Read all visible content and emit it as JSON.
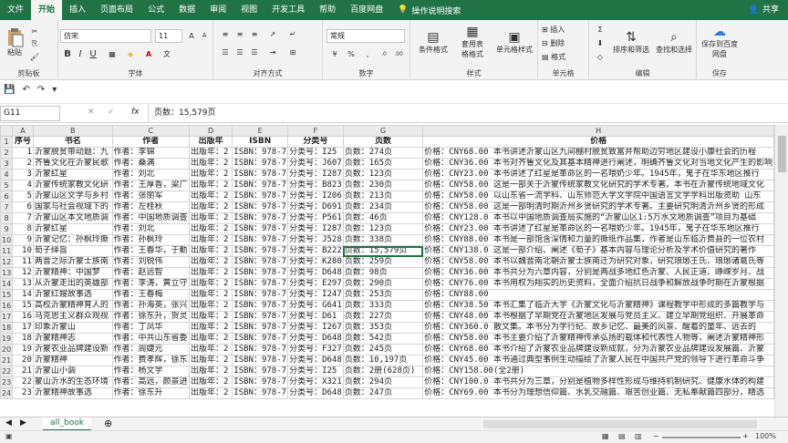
{
  "ribbon_tabs": [
    "文件",
    "开始",
    "插入",
    "页面布局",
    "公式",
    "数据",
    "审阅",
    "视图",
    "开发工具",
    "帮助",
    "百度网盘"
  ],
  "tell_me": "操作说明搜索",
  "share": "共享",
  "groups": {
    "clipboard": {
      "label": "剪贴板",
      "paste": "粘贴"
    },
    "font": {
      "label": "字体",
      "name": "仿宋",
      "size": "11",
      "bold": "B",
      "italic": "I",
      "underline": "U"
    },
    "alignment": {
      "label": "对齐方式"
    },
    "number": {
      "label": "数字",
      "format": "常规"
    },
    "styles": {
      "label": "样式",
      "conditional": "条件格式",
      "table": "套用表格格式",
      "cell_styles": "单元格样式"
    },
    "cells": {
      "label": "单元格",
      "insert": "插入",
      "delete": "删除",
      "format": "格式"
    },
    "editing": {
      "label": "编辑",
      "sort": "排序和筛选",
      "find": "查找和选择"
    },
    "save": {
      "label": "保存",
      "btn": "保存到百度网盘"
    }
  },
  "namebox": "G11",
  "formula": "页数：15,579页",
  "columns": [
    "A",
    "B",
    "C",
    "D",
    "E",
    "F",
    "G",
    "H"
  ],
  "header_row": [
    "序号",
    "书名",
    "作者",
    "出版年",
    "ISBN",
    "分类号",
    "页数",
    "价格"
  ],
  "rows": [
    [
      "1",
      "沂蒙脱贫带动题：九",
      "作者：李锦",
      "出版年：2",
      "ISBN：978-7",
      "分类号：I25",
      "页数：274页",
      "价格：CNY68.00 本书讲述沂蒙山区九间棚村脱贫致富并帮助边穷地区建设小康社会的历程"
    ],
    [
      "2",
      "齐鲁文化在沂蒙民歌",
      "作者：桑满",
      "出版年：2",
      "ISBN：978-7",
      "分类号：J607",
      "页数：165页",
      "价格：CNY36.00 本书对齐鲁文化及其基本精神进行阐述，明确齐鲁文化对当地文化产生的影响"
    ],
    [
      "3",
      "沂蒙红星",
      "作者：刘北",
      "出版年：2",
      "ISBN：978-7",
      "分类号：I287",
      "页数：123页",
      "价格：CNY23.00 本书讲述了红星是革命区的一名喂奶少年。1945年，鬼子在华东地区推行"
    ],
    [
      "4",
      "沂蒙传统家教文化研",
      "作者：王厚香，梁广",
      "出版年：2",
      "ISBN：978-7",
      "分类号：B823",
      "页数：230页",
      "价格：CNY58.00 这是一部关于沂蒙传统家教文化研究的学术专著。本书在沂蒙传统地域文化"
    ],
    [
      "5",
      "沂蒙山区文学与乡村",
      "作者：张丽军",
      "出版年：2",
      "ISBN：978-7",
      "分类号：I206",
      "页数：213页",
      "价格：CNY58.00 以山东省一流学科、山东师范大学文学院中国语言文学学科出版资助 山东"
    ],
    [
      "6",
      "国家与社会视域下的",
      "作者：左桂秋",
      "出版年：2",
      "ISBN：978-7",
      "分类号：D691",
      "页数：234页",
      "价格：CNY58.00 这是一部明清时期沂州乡贤研究的学术专著。主要研究明清沂州乡贤的形成"
    ],
    [
      "7",
      "沂蒙山区本文地质调",
      "作者：中国地质调查",
      "出版年：2",
      "ISBN：978-7",
      "分类号：P561",
      "页数：46页",
      "价格：CNY128.0 本书以中国地质调查局实施的“沂蒙山区1:5万水文地质调查”项目为基础"
    ],
    [
      "8",
      "沂蒙红星",
      "作者：刘北",
      "出版年：2",
      "ISBN：978-7",
      "分类号：I287",
      "页数：123页",
      "价格：CNY23.00 本书讲述了红星是革命区的一名喂奶少年。1945年，鬼子在华东地区推行"
    ],
    [
      "9",
      "沂蒙记忆：孙枫玲撕",
      "作者：孙枫玲",
      "出版年：2",
      "ISBN：978-7",
      "分类号：J528",
      "页数：338页",
      "价格：CNY88.00 本书是一部饱含深情和力量的撕纸作品集，作者是山东临沂费县的一位农村"
    ],
    [
      "10",
      "荀子绎旨",
      "作者：王春华，于勤",
      "出版年：2",
      "ISBN：978-7",
      "分类号：B222",
      "页数：15,579页",
      "价格：CNY138.0 这是一部介绍、阐述《荀子》基本内容与理论分析及学术价值研究的著作"
    ],
    [
      "11",
      "两晋之际沂蒙士族南",
      "作者：刘锐伟",
      "出版年：2",
      "ISBN：978-7",
      "分类号：K280",
      "页数：259页",
      "价格：CNY58.00 本书以魏晋南北朝沂蒙士族南迁为研究对象，研究琅琊王氏、琅琊诸葛氏等"
    ],
    [
      "12",
      "沂蒙精神：中国梦",
      "作者：赵远智",
      "出版年：2",
      "ISBN：978-7",
      "分类号：D648",
      "页数：98页",
      "价格：CNY36.00 本书共分为六章内容，分别是两战多地红色沂蒙、人民正道、峥嵘岁月、战"
    ],
    [
      "13",
      "从沂蒙走出的英雄部",
      "作者：李涛，黄立守",
      "出版年：2",
      "ISBN：978-7",
      "分类号：E297",
      "页数：290页",
      "价格：CNY76.00 本书用权为翔实的历史资料，全面介绍抗日战争和解放战争时期在沂蒙根据"
    ],
    [
      "14",
      "沂蒙红嫂故事选",
      "作者：王春梅",
      "出版年：2",
      "ISBN：978-7",
      "分类号：I247",
      "页数：253页",
      "价格：CNY88.00"
    ],
    [
      "15",
      "高校沂蒙精神育人的",
      "作者：孙海英，张兴",
      "出版年：2",
      "ISBN：978-7",
      "分类号：G641",
      "页数：333页",
      "价格：CNY38.50 本书汇集了临沂大学《沂蒙文化与沂蒙精神》课程教学中形成的多篇教学与"
    ],
    [
      "16",
      "马克思主义群众观视",
      "作者：徐东升，贺灵",
      "出版年：2",
      "ISBN：978-7",
      "分类号：D61",
      "页数：227页",
      "价格：CNY48.00 本书根据了早期党在沂蒙地区发展与党员主义、建立早期党组织、开展革命"
    ],
    [
      "17",
      "印象沂蒙山",
      "作者：丁凤华",
      "出版年：2",
      "ISBN：978-7",
      "分类号：I267",
      "页数：353页",
      "价格：CNY360.0 散文集。本书分为学行纪、故乡记忆、最美的风景、醒着的童年、远去的"
    ],
    [
      "18",
      "沂蒙精神志",
      "作者：中共山东省委",
      "出版年：2",
      "ISBN：978-7",
      "分类号：D648",
      "页数：542页",
      "价格：CNY58.00 本书主要介绍了沂蒙精神传承弘扬的载体和代表性人物等，阐述沂蒙精神形"
    ],
    [
      "19",
      "沂蒙农业品牌建设新",
      "作者：周婕元",
      "出版年：2",
      "ISBN：978-7",
      "分类号：F327",
      "页数：245页",
      "价格：CNY68.00 本书介绍了沂蒙农业品牌建设新成就，分为沂蒙农业品牌建设发展篇、沂蒙"
    ],
    [
      "20",
      "沂蒙精神",
      "作者：费孝辉，徐东",
      "出版年：2",
      "ISBN：978-7",
      "分类号：D648",
      "页数：10,197页",
      "价格：CNY45.00 本书通过典型事例生动描绘了沂蒙人民在中国共产党的领导下进行革命斗争"
    ],
    [
      "21",
      "沂蒙山小调",
      "作者：杨文学",
      "出版年：2",
      "ISBN：978-7",
      "分类号：I25",
      "页数：2册(628页)",
      "价格：CNY158.00(全2册)"
    ],
    [
      "22",
      "蒙山沂水的生态环境",
      "作者：高远，颜景进",
      "出版年：2",
      "ISBN：978-7",
      "分类号：X321",
      "页数：294页",
      "价格：CNY100.0 本书共分为三章，分别是植物多样性形成与维持机制研究、健康水体的构建"
    ],
    [
      "23",
      "沂蒙精神故事选",
      "作者：徐东升",
      "出版年：2",
      "ISBN：978-7",
      "分类号：D648",
      "页数：247页",
      "价格：CNY69.00 本书分为理想信仰篇、水乳交融篇、艰苦创业篇、无私奉献篇四部分，精选"
    ]
  ],
  "sheet_name": "all_book",
  "zoom": "100%"
}
